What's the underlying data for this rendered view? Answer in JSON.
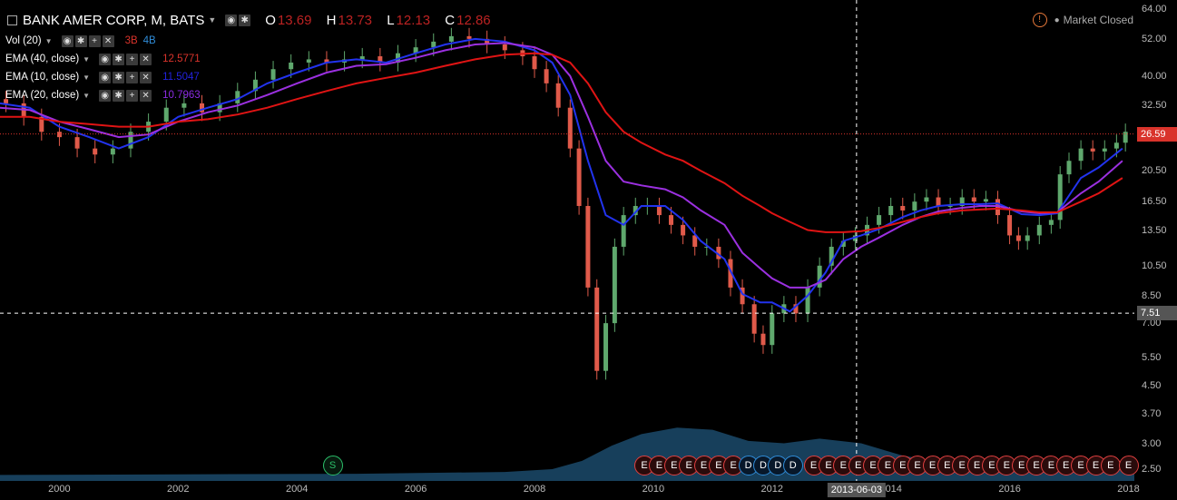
{
  "header": {
    "symbol": "BANK AMER CORP, M, BATS",
    "ohlc": [
      {
        "k": "O",
        "v": "13.69"
      },
      {
        "k": "H",
        "v": "13.73"
      },
      {
        "k": "L",
        "v": "12.13"
      },
      {
        "k": "C",
        "v": "12.86"
      }
    ]
  },
  "indicators": [
    {
      "label": "Vol (20)",
      "values": [
        {
          "text": "3B",
          "color": "#d9332b"
        },
        {
          "text": "4B",
          "color": "#2f8cd8"
        }
      ]
    },
    {
      "label": "EMA (40, close)",
      "values": [
        {
          "text": "12.5771",
          "color": "#d9332b"
        }
      ]
    },
    {
      "label": "EMA (10, close)",
      "values": [
        {
          "text": "11.5047",
          "color": "#2222dd"
        }
      ]
    },
    {
      "label": "EMA (20, close)",
      "values": [
        {
          "text": "10.7963",
          "color": "#8a2be2"
        }
      ]
    }
  ],
  "status": {
    "market": "Market Closed"
  },
  "axes": {
    "y_ticks": [
      "64.00",
      "52.00",
      "40.00",
      "32.50",
      "26.59",
      "20.50",
      "16.50",
      "13.50",
      "10.50",
      "8.50",
      "7.51",
      "7.00",
      "5.50",
      "4.50",
      "3.70",
      "3.00",
      "2.50"
    ],
    "x_ticks": [
      "2000",
      "2002",
      "2004",
      "2006",
      "2008",
      "2010",
      "2012",
      "2014",
      "2016",
      "2018"
    ],
    "price_label": "26.59",
    "crosshair_y_label": "7.51",
    "crosshair_x_label": "2013-06-03"
  },
  "events": [
    {
      "type": "S",
      "label": "S",
      "year": 2004.6
    },
    {
      "type": "E",
      "label": "E",
      "year": 2009.85
    },
    {
      "type": "E",
      "label": "E",
      "year": 2010.1
    },
    {
      "type": "E",
      "label": "E",
      "year": 2010.35
    },
    {
      "type": "E",
      "label": "E",
      "year": 2010.6
    },
    {
      "type": "E",
      "label": "E",
      "year": 2010.85
    },
    {
      "type": "E",
      "label": "E",
      "year": 2011.1
    },
    {
      "type": "E",
      "label": "E",
      "year": 2011.35
    },
    {
      "type": "D",
      "label": "D",
      "year": 2011.6
    },
    {
      "type": "D",
      "label": "D",
      "year": 2011.85
    },
    {
      "type": "D",
      "label": "D",
      "year": 2012.1
    },
    {
      "type": "D",
      "label": "D",
      "year": 2012.35
    },
    {
      "type": "E",
      "label": "E",
      "year": 2012.7
    },
    {
      "type": "E",
      "label": "E",
      "year": 2012.95
    },
    {
      "type": "E",
      "label": "E",
      "year": 2013.2
    },
    {
      "type": "E",
      "label": "E",
      "year": 2013.45
    },
    {
      "type": "E",
      "label": "E",
      "year": 2013.7
    },
    {
      "type": "E",
      "label": "E",
      "year": 2013.95
    },
    {
      "type": "E",
      "label": "E",
      "year": 2014.2
    },
    {
      "type": "E",
      "label": "E",
      "year": 2014.45
    },
    {
      "type": "E",
      "label": "E",
      "year": 2014.7
    },
    {
      "type": "E",
      "label": "E",
      "year": 2014.95
    },
    {
      "type": "E",
      "label": "E",
      "year": 2015.2
    },
    {
      "type": "E",
      "label": "E",
      "year": 2015.45
    },
    {
      "type": "E",
      "label": "E",
      "year": 2015.7
    },
    {
      "type": "E",
      "label": "E",
      "year": 2015.95
    },
    {
      "type": "E",
      "label": "E",
      "year": 2016.2
    },
    {
      "type": "E",
      "label": "E",
      "year": 2016.45
    },
    {
      "type": "E",
      "label": "E",
      "year": 2016.7
    },
    {
      "type": "E",
      "label": "E",
      "year": 2016.95
    },
    {
      "type": "E",
      "label": "E",
      "year": 2017.2
    },
    {
      "type": "E",
      "label": "E",
      "year": 2017.45
    },
    {
      "type": "E",
      "label": "E",
      "year": 2017.7
    },
    {
      "type": "E",
      "label": "E",
      "year": 2018.0
    }
  ],
  "colors": {
    "background": "#000000",
    "up_candle": "#5fa86d",
    "down_candle": "#e05a4a",
    "ema10": "#2233ee",
    "ema20": "#9b30e0",
    "ema40": "#e01414",
    "volume_area": "#1b4a6b",
    "price_line": "#d9332b",
    "crosshair": "#ffffff"
  },
  "chart_data": {
    "type": "line",
    "x_unit": "year",
    "y_scale": "log",
    "ylim": [
      2.3,
      65
    ],
    "xlim": [
      1999.0,
      2018.1
    ],
    "series": [
      {
        "name": "EMA (10, close)",
        "color": "#2233ee",
        "x": [
          1999.0,
          1999.5,
          2000.0,
          2000.5,
          2001.0,
          2001.5,
          2002.0,
          2002.5,
          2003.0,
          2003.5,
          2004.0,
          2004.5,
          2005.0,
          2005.5,
          2006.0,
          2006.5,
          2007.0,
          2007.5,
          2008.0,
          2008.3,
          2008.6,
          2008.9,
          2009.2,
          2009.5,
          2009.8,
          2010.2,
          2010.5,
          2010.8,
          2011.2,
          2011.5,
          2011.8,
          2012.0,
          2012.3,
          2012.6,
          2012.9,
          2013.2,
          2013.5,
          2013.8,
          2014.2,
          2014.5,
          2014.8,
          2015.2,
          2015.5,
          2015.8,
          2016.2,
          2016.5,
          2016.8,
          2017.2,
          2017.5,
          2017.9
        ],
        "y": [
          33,
          32,
          28,
          26,
          24,
          26,
          30,
          32,
          34,
          38,
          41,
          44,
          45,
          44,
          47,
          50,
          52,
          51,
          48,
          44,
          35,
          22,
          15,
          14,
          16,
          16,
          14.5,
          12.5,
          11,
          8.6,
          8.1,
          8.1,
          7.6,
          8.5,
          10,
          12.5,
          13,
          13.6,
          14.8,
          15.5,
          16,
          16.2,
          16.2,
          16.3,
          15.1,
          15,
          15.2,
          19.5,
          21,
          24
        ]
      },
      {
        "name": "EMA (20, close)",
        "color": "#9b30e0",
        "x": [
          1999.0,
          1999.5,
          2000.0,
          2000.5,
          2001.0,
          2001.5,
          2002.0,
          2002.5,
          2003.0,
          2003.5,
          2004.0,
          2004.5,
          2005.0,
          2005.5,
          2006.0,
          2006.5,
          2007.0,
          2007.5,
          2008.0,
          2008.3,
          2008.6,
          2008.9,
          2009.2,
          2009.5,
          2009.8,
          2010.2,
          2010.5,
          2010.8,
          2011.2,
          2011.5,
          2011.8,
          2012.0,
          2012.3,
          2012.6,
          2012.9,
          2013.2,
          2013.5,
          2013.8,
          2014.2,
          2014.5,
          2014.8,
          2015.2,
          2015.5,
          2015.8,
          2016.2,
          2016.5,
          2016.8,
          2017.2,
          2017.5,
          2017.9
        ],
        "y": [
          32,
          31.5,
          29,
          27.5,
          26,
          26.5,
          29,
          31,
          32.5,
          35,
          38,
          41,
          43,
          43.5,
          45.5,
          48,
          50,
          50.5,
          49,
          46.5,
          40,
          30,
          22,
          19,
          18.5,
          18,
          17,
          15.5,
          14,
          11.5,
          10.3,
          9.6,
          9,
          9,
          9.5,
          11,
          12,
          12.8,
          14,
          14.8,
          15.4,
          15.8,
          16,
          16,
          15.4,
          15.2,
          15.3,
          17.5,
          19,
          22
        ]
      },
      {
        "name": "EMA (40, close)",
        "color": "#e01414",
        "x": [
          1999.0,
          1999.5,
          2000.0,
          2000.5,
          2001.0,
          2001.5,
          2002.0,
          2002.5,
          2003.0,
          2003.5,
          2004.0,
          2004.5,
          2005.0,
          2005.5,
          2006.0,
          2006.5,
          2007.0,
          2007.5,
          2008.0,
          2008.3,
          2008.6,
          2008.9,
          2009.2,
          2009.5,
          2009.8,
          2010.2,
          2010.5,
          2010.8,
          2011.2,
          2011.5,
          2011.8,
          2012.0,
          2012.3,
          2012.6,
          2012.9,
          2013.2,
          2013.5,
          2013.8,
          2014.2,
          2014.5,
          2014.8,
          2015.2,
          2015.5,
          2015.8,
          2016.2,
          2016.5,
          2016.8,
          2017.2,
          2017.5,
          2017.9
        ],
        "y": [
          30,
          30,
          29,
          28.5,
          28,
          28,
          29,
          29.5,
          30.5,
          32,
          34,
          36,
          38,
          39.5,
          41,
          43,
          45,
          46.5,
          47,
          46.5,
          44,
          38,
          31,
          27,
          25,
          23,
          22,
          20.5,
          18.8,
          17.2,
          16,
          15.2,
          14.3,
          13.5,
          13.3,
          13.3,
          13.4,
          13.7,
          14.3,
          14.8,
          15.2,
          15.5,
          15.6,
          15.7,
          15.5,
          15.3,
          15.3,
          16.5,
          17.5,
          19.5
        ]
      }
    ],
    "candles": {
      "x": [
        1999.1,
        1999.4,
        1999.7,
        2000.0,
        2000.3,
        2000.6,
        2000.9,
        2001.2,
        2001.5,
        2001.8,
        2002.1,
        2002.4,
        2002.7,
        2003.0,
        2003.3,
        2003.6,
        2003.9,
        2004.2,
        2004.5,
        2004.8,
        2005.1,
        2005.4,
        2005.7,
        2006.0,
        2006.3,
        2006.6,
        2006.9,
        2007.2,
        2007.5,
        2007.8,
        2008.0,
        2008.2,
        2008.4,
        2008.6,
        2008.75,
        2008.9,
        2009.05,
        2009.2,
        2009.35,
        2009.5,
        2009.7,
        2009.9,
        2010.1,
        2010.3,
        2010.5,
        2010.7,
        2010.9,
        2011.1,
        2011.3,
        2011.5,
        2011.7,
        2011.85,
        2012.0,
        2012.2,
        2012.4,
        2012.6,
        2012.8,
        2013.0,
        2013.2,
        2013.4,
        2013.6,
        2013.8,
        2014.0,
        2014.2,
        2014.4,
        2014.6,
        2014.8,
        2015.0,
        2015.2,
        2015.4,
        2015.6,
        2015.8,
        2016.0,
        2016.15,
        2016.3,
        2016.5,
        2016.7,
        2016.85,
        2017.0,
        2017.2,
        2017.4,
        2017.6,
        2017.8,
        2017.95
      ],
      "open": [
        34,
        33,
        30,
        27,
        26,
        24,
        23,
        24,
        27,
        29,
        32,
        33,
        31,
        33,
        36,
        39,
        42,
        44,
        45,
        44,
        45,
        46,
        44,
        47,
        49,
        51,
        53,
        52,
        50,
        48,
        46,
        42,
        38,
        32,
        24,
        16,
        9,
        5,
        7,
        12,
        15,
        16,
        16,
        15,
        14,
        13,
        12,
        12,
        11,
        9,
        8,
        6.5,
        6,
        7.5,
        8,
        7.5,
        9,
        10.5,
        12,
        12.5,
        13,
        14,
        15,
        16,
        15.5,
        16.5,
        17,
        16,
        16,
        17,
        16.5,
        16.8,
        15,
        13,
        12.5,
        13,
        14,
        14.5,
        20,
        22,
        24,
        23.5,
        24,
        25
      ],
      "close": [
        33,
        30,
        27,
        26,
        24,
        23,
        24,
        27,
        29,
        32,
        33,
        31,
        33,
        36,
        39,
        42,
        44,
        45,
        44,
        45,
        46,
        44,
        47,
        49,
        51,
        53,
        52,
        50,
        48,
        46,
        42,
        38,
        32,
        24,
        16,
        9,
        5,
        7,
        12,
        15,
        16,
        16,
        15,
        14,
        13,
        12,
        12,
        11,
        9,
        8,
        6.5,
        6,
        7.5,
        8,
        7.5,
        9,
        10.5,
        12,
        12.5,
        13,
        14,
        15,
        16,
        15.5,
        16.5,
        17,
        16,
        16,
        17,
        16.5,
        16.8,
        15,
        13,
        12.5,
        13,
        14,
        14.5,
        20,
        22,
        24,
        23.5,
        24,
        25,
        27
      ]
    },
    "volume_area": {
      "x": [
        1999.0,
        2005.0,
        2007.5,
        2008.3,
        2008.8,
        2009.3,
        2009.8,
        2010.4,
        2011.0,
        2011.6,
        2012.2,
        2012.8,
        2013.5,
        2014.2,
        2015.0,
        2016.0,
        2018.1
      ],
      "y": [
        2.4,
        2.42,
        2.45,
        2.5,
        2.65,
        2.95,
        3.2,
        3.35,
        3.3,
        3.05,
        3.0,
        3.1,
        3.0,
        2.75,
        2.6,
        2.55,
        2.5
      ]
    }
  }
}
